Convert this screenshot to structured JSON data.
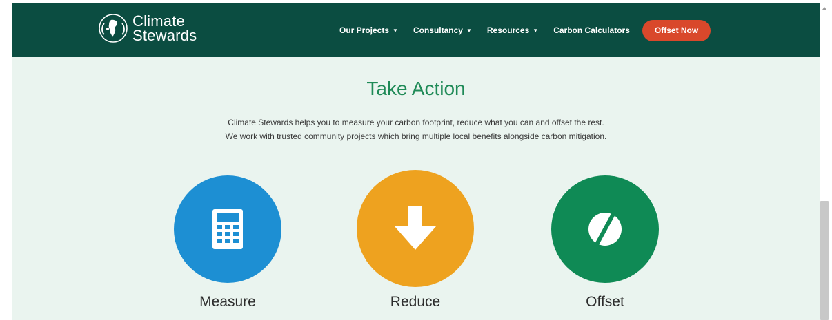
{
  "brand": {
    "name_line1": "Climate",
    "name_line2": "Stewards"
  },
  "nav": {
    "items": [
      {
        "label": "Our Projects",
        "has_dropdown": true
      },
      {
        "label": "Consultancy",
        "has_dropdown": true
      },
      {
        "label": "Resources",
        "has_dropdown": true
      },
      {
        "label": "Carbon Calculators",
        "has_dropdown": false
      }
    ],
    "caret": "▼",
    "cta_label": "Offset Now"
  },
  "main": {
    "title": "Take Action",
    "intro_line1": "Climate Stewards helps you to measure your carbon footprint, reduce what you can and offset the rest.",
    "intro_line2": "We work with trusted community projects which bring multiple local benefits alongside carbon mitigation.",
    "actions": [
      {
        "label": "Measure",
        "icon": "calculator-icon",
        "color": "#1d8fd3"
      },
      {
        "label": "Reduce",
        "icon": "arrow-down-icon",
        "color": "#eea21f"
      },
      {
        "label": "Offset",
        "icon": "offset-icon",
        "color": "#0f8a55"
      }
    ]
  },
  "colors": {
    "header_bg": "#0b4d41",
    "page_bg": "#eaf4ef",
    "title": "#1f8a57",
    "cta": "#d9482b"
  }
}
